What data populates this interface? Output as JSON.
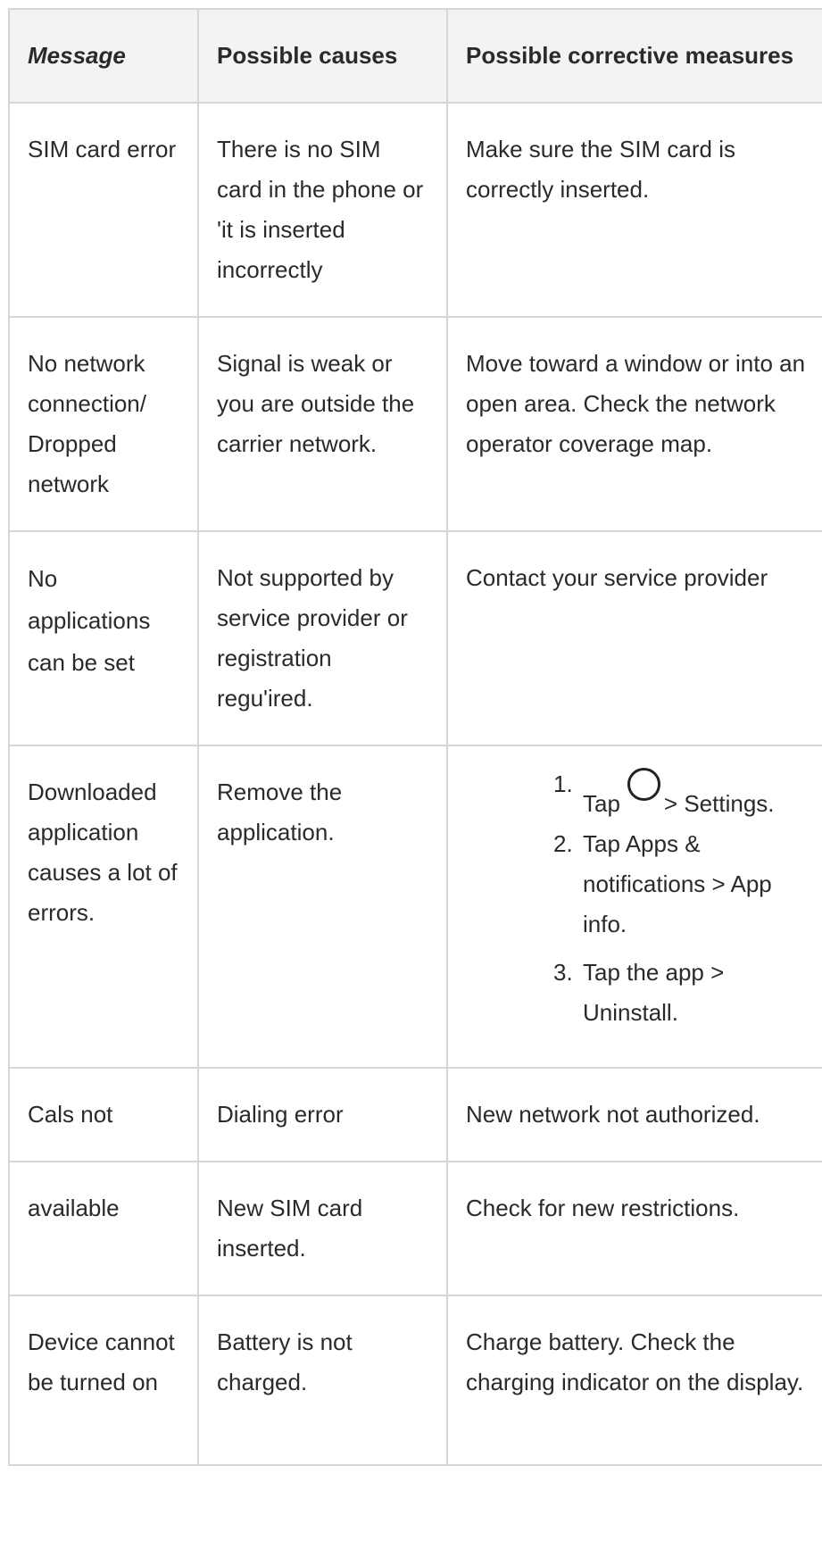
{
  "table": {
    "headers": [
      "Message",
      "Possible causes",
      "Possible corrective measures"
    ],
    "rows": [
      {
        "message": "SIM card error",
        "cause": "There is no SIM card in the phone or 'it is inserted incorrectly",
        "measure": "Make sure the SIM card is correctly inserted."
      },
      {
        "message": "No network connection/ Dropped network",
        "cause": "Signal is weak or you are outside the carrier network.",
        "measure": "Move toward a window or into an open area. Check the network operator coverage map."
      },
      {
        "message": "No applications can be set",
        "cause": "Not supported by service provider or registration regu'ired.",
        "measure": "Contact your service provider"
      },
      {
        "message": "Downloaded application causes a lot of errors.",
        "cause": "Remove the application.",
        "steps": [
          {
            "num": "1.",
            "pre": "Tap",
            "icon": "home-circle-icon",
            "post": "> Settings."
          },
          {
            "num": "2.",
            "text": "Tap Apps & notifications > App info."
          },
          {
            "num": "3.",
            "text": "Tap the app > Uninstall."
          }
        ]
      },
      {
        "message": "Cals not",
        "cause": "Dialing error",
        "measure": "New network not authorized."
      },
      {
        "message": "available",
        "cause": "New SIM card inserted.",
        "measure": "Check for new restrictions."
      },
      {
        "message": "Device cannot be turned on",
        "cause": "Battery is not charged.",
        "measure": "Charge battery. Check the charging indicator on the display."
      }
    ]
  }
}
